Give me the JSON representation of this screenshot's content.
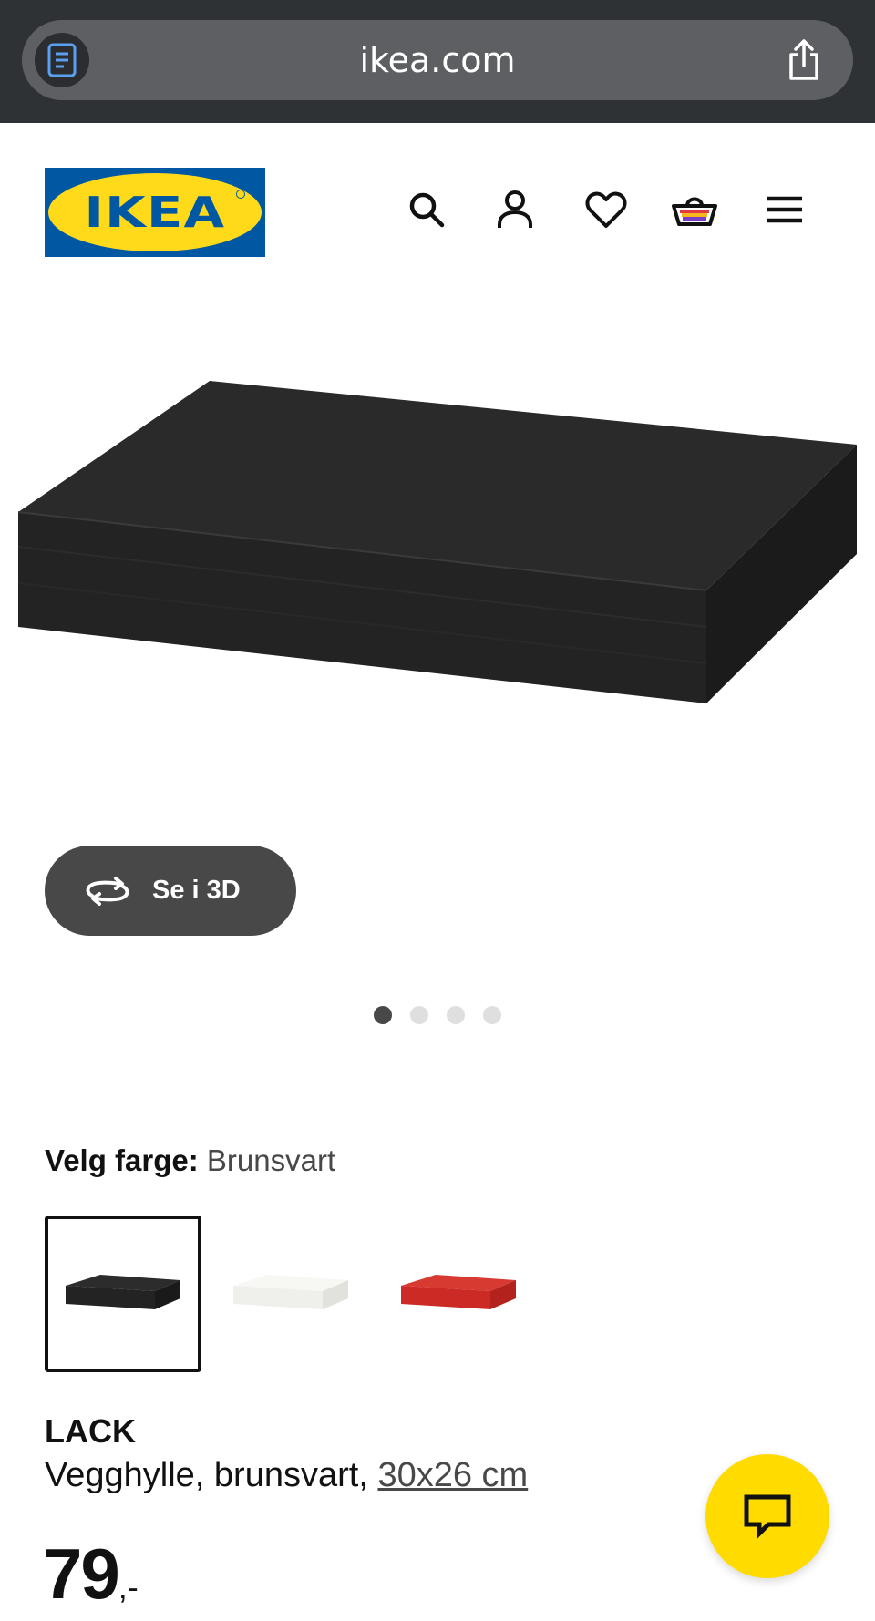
{
  "browser": {
    "url": "ikea.com",
    "reader_icon": "reader-mode-icon",
    "share_icon": "share-icon"
  },
  "header": {
    "logo_text": "IKEA",
    "icons": [
      "search-icon",
      "account-icon",
      "heart-icon",
      "basket-icon",
      "menu-icon"
    ],
    "brand_colors": {
      "blue": "#0058a3",
      "yellow": "#ffda1a"
    }
  },
  "gallery": {
    "view_3d_label": "Se i 3D",
    "total_images": 4,
    "active_index": 0
  },
  "color_picker": {
    "label": "Velg farge:",
    "selected_value": "Brunsvart",
    "options": [
      {
        "name": "Brunsvart",
        "color": "#232323",
        "selected": true
      },
      {
        "name": "White",
        "color": "#f2f2ee",
        "selected": false
      },
      {
        "name": "Red",
        "color": "#cc2a24",
        "selected": false
      }
    ]
  },
  "product": {
    "name": "LACK",
    "description": "Vegghylle, brunsvart,",
    "size_link": "30x26 cm",
    "price": "79",
    "price_suffix": ",-"
  },
  "chat": {
    "icon": "chat-icon",
    "color": "#ffdb00"
  }
}
